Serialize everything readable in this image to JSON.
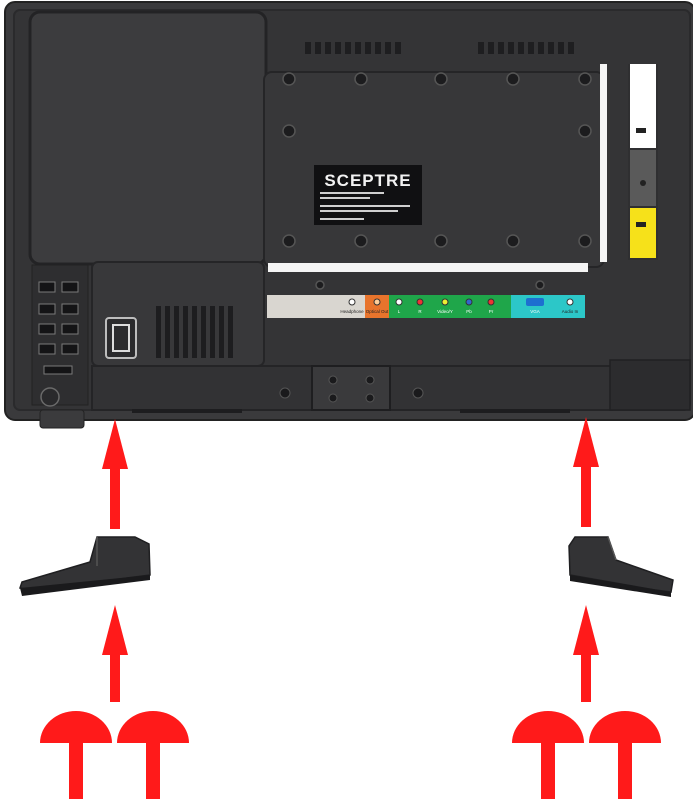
{
  "brand": "SCEPTRE",
  "ports": {
    "headphone": "Headphone",
    "optical": "Optical Out",
    "l": "L",
    "r": "R",
    "video": "Video/Y",
    "pb": "Pb",
    "pr": "Pr",
    "vga": "VGA",
    "audio_in": "Audio In"
  },
  "colors": {
    "body": "#3b3b3d",
    "body_dark": "#2a2a2c",
    "arrow": "#ff1a1a",
    "stand": "#2d2d2f",
    "green": "#1fa64a",
    "orange": "#e8742c",
    "teal": "#2cc7c8",
    "yellow": "#f6e11a",
    "light_panel": "#d9d6d0"
  },
  "icons": [
    "arrow-up-icon",
    "screw-icon",
    "stand-foot-icon"
  ]
}
